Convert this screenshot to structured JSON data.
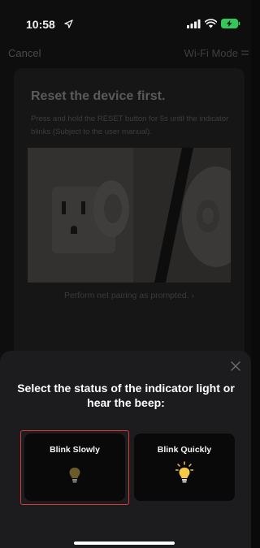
{
  "status_bar": {
    "time": "10:58"
  },
  "nav": {
    "cancel_label": "Cancel",
    "mode_label": "Wi-Fi Mode"
  },
  "background_card": {
    "title": "Reset the device first.",
    "description": "Press and hold the RESET button for 5s until the indicator blinks (Subject to the user manual).",
    "link_text": "Perform net pairing as prompted. ›"
  },
  "sheet": {
    "title": "Select the status of the indicator light or hear the beep:",
    "options": [
      {
        "label": "Blink Slowly",
        "icon": "bulb-off-icon",
        "selected": true
      },
      {
        "label": "Blink Quickly",
        "icon": "bulb-on-icon",
        "selected": false
      }
    ]
  },
  "colors": {
    "highlight_border": "#e0363a",
    "sheet_background": "#1c1c1e",
    "bulb_glow": "#f2c14e"
  }
}
